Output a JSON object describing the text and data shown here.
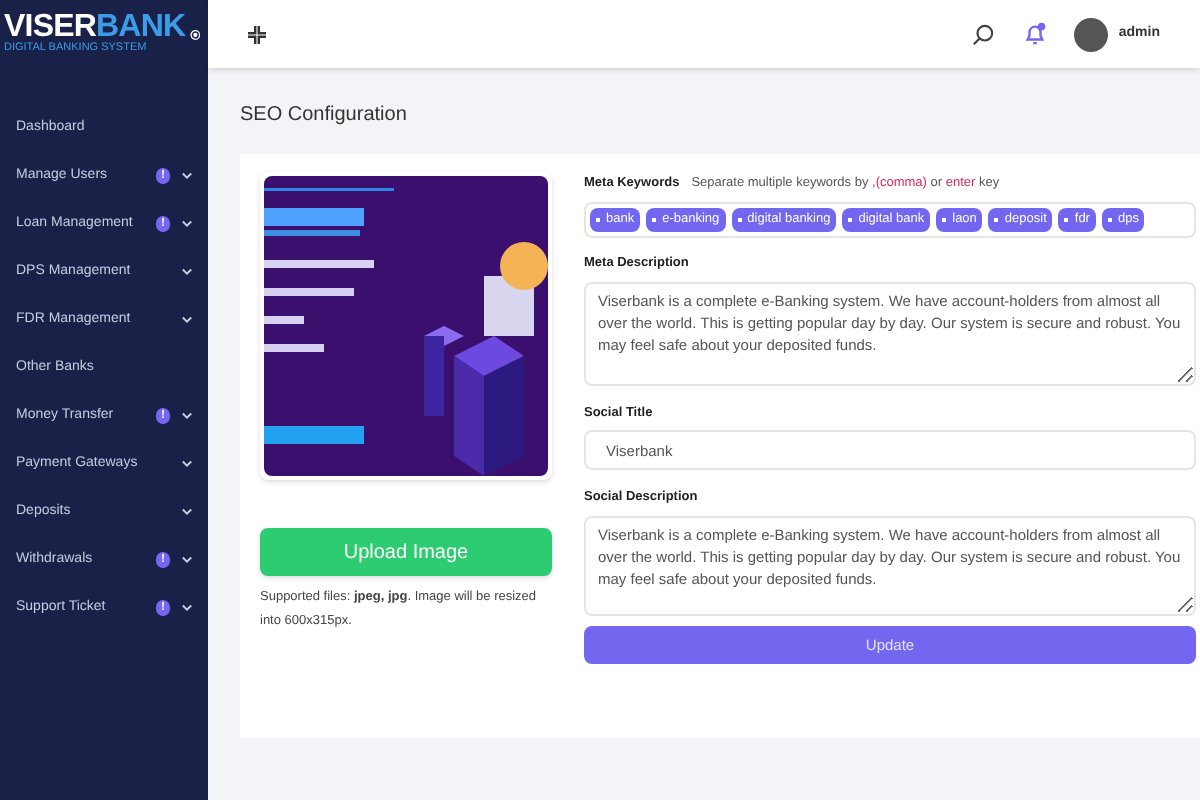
{
  "logo": {
    "name_a": "VISER",
    "name_b": "BANK",
    "tagline": "DIGITAL BANKING SYSTEM"
  },
  "sidebar": {
    "items": [
      {
        "label": "Dashboard",
        "badge": false,
        "expandable": false
      },
      {
        "label": "Manage Users",
        "badge": true,
        "expandable": true
      },
      {
        "label": "Loan Management",
        "badge": true,
        "expandable": true
      },
      {
        "label": "DPS Management",
        "badge": false,
        "expandable": true
      },
      {
        "label": "FDR Management",
        "badge": false,
        "expandable": true
      },
      {
        "label": "Other Banks",
        "badge": false,
        "expandable": false
      },
      {
        "label": "Money Transfer",
        "badge": true,
        "expandable": true
      },
      {
        "label": "Payment Gateways",
        "badge": false,
        "expandable": true
      },
      {
        "label": "Deposits",
        "badge": false,
        "expandable": true
      },
      {
        "label": "Withdrawals",
        "badge": true,
        "expandable": true
      },
      {
        "label": "Support Ticket",
        "badge": true,
        "expandable": true
      }
    ]
  },
  "badge_text": "!",
  "topbar": {
    "user": "admin"
  },
  "page_title": "SEO Configuration",
  "image_panel": {
    "upload_button": "Upload Image",
    "note": "Supported files: **jpeg, jpg**. Image will be resized into 600x315px."
  },
  "form": {
    "keywords": {
      "label": "Meta Keywords",
      "hint_a": "Separate multiple keywords by",
      "hint_b": ",(comma)",
      "hint_c": "or",
      "hint_d": "enter",
      "hint_e": "key",
      "tags": [
        "bank",
        "e-banking",
        "digital banking",
        "digital bank",
        "laon",
        "deposit",
        "fdr",
        "dps"
      ]
    },
    "meta_description": {
      "label": "Meta Description",
      "value": "Viserbank is a complete e-Banking system. We have account-holders from almost all over the world. This is getting popular day by day. Our system is secure and robust. You may feel safe about your deposited funds."
    },
    "social_title": {
      "label": "Social Title",
      "value": "Viserbank"
    },
    "social_description": {
      "label": "Social Description",
      "value": "Viserbank is a complete e-Banking system. We have account-holders from almost all over the world. This is getting popular day by day. Our system is secure and robust. You may feel safe about your deposited funds."
    },
    "submit": "Update"
  }
}
